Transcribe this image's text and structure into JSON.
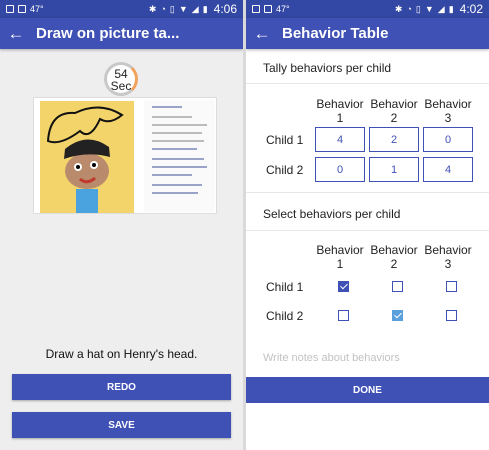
{
  "left": {
    "status": {
      "temp": "47°",
      "time": "4:06"
    },
    "app_bar": {
      "back_icon": "arrow-left-icon",
      "title": "Draw on picture ta..."
    },
    "timer": {
      "seconds": "54",
      "unit": "Sec"
    },
    "instruction": "Draw a hat on Henry's head.",
    "buttons": {
      "redo": "REDO",
      "save": "SAVE"
    }
  },
  "right": {
    "status": {
      "temp": "47°",
      "time": "4:02"
    },
    "app_bar": {
      "back_icon": "arrow-left-icon",
      "title": "Behavior Table"
    },
    "tally": {
      "section_title": "Tally behaviors per child",
      "columns": [
        "Behavior 1",
        "Behavior 2",
        "Behavior 3"
      ],
      "rows": [
        {
          "label": "Child 1",
          "values": [
            "4",
            "2",
            "0"
          ]
        },
        {
          "label": "Child 2",
          "values": [
            "0",
            "1",
            "4"
          ]
        }
      ]
    },
    "select": {
      "section_title": "Select behaviors per child",
      "columns": [
        "Behavior 1",
        "Behavior 2",
        "Behavior 3"
      ],
      "rows": [
        {
          "label": "Child 1",
          "checked": [
            true,
            false,
            false
          ]
        },
        {
          "label": "Child 2",
          "checked": [
            false,
            true,
            false
          ]
        }
      ]
    },
    "notes_placeholder": "Write notes about behaviors",
    "done_label": "DONE"
  },
  "colors": {
    "primary": "#3f51b5",
    "status_bar": "#3347a4",
    "timer_progress": "#f1a35d"
  }
}
